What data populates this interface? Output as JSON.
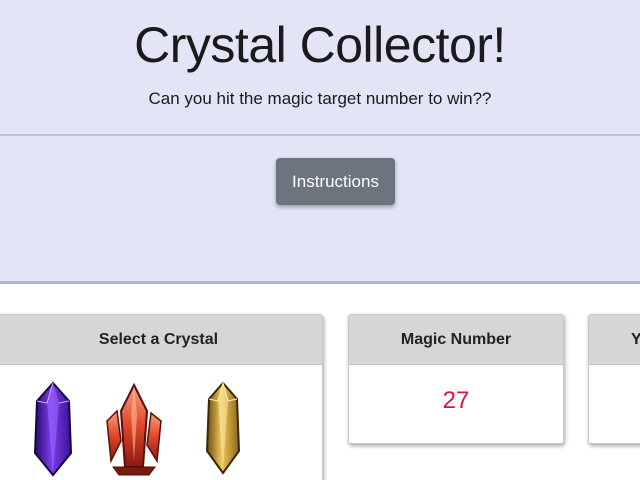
{
  "header": {
    "title": "Crystal Collector!",
    "subtitle": "Can you hit the magic target number to win??",
    "instructions_label": "Instructions"
  },
  "cards": {
    "crystals": {
      "title": "Select a Crystal",
      "items": [
        {
          "name": "purple-crystal",
          "color": "#5b1fb5"
        },
        {
          "name": "red-crystal",
          "color": "#d9452b"
        },
        {
          "name": "gold-crystal",
          "color": "#c89a2a"
        }
      ]
    },
    "magic": {
      "title": "Magic Number",
      "value": "27",
      "value_color": "#dc143c"
    },
    "yours": {
      "title": "Yo"
    }
  },
  "colors": {
    "jumbotron_bg": "#e4e4f7",
    "button_bg": "#6c757d",
    "card_header_bg": "#d6d6d6"
  }
}
